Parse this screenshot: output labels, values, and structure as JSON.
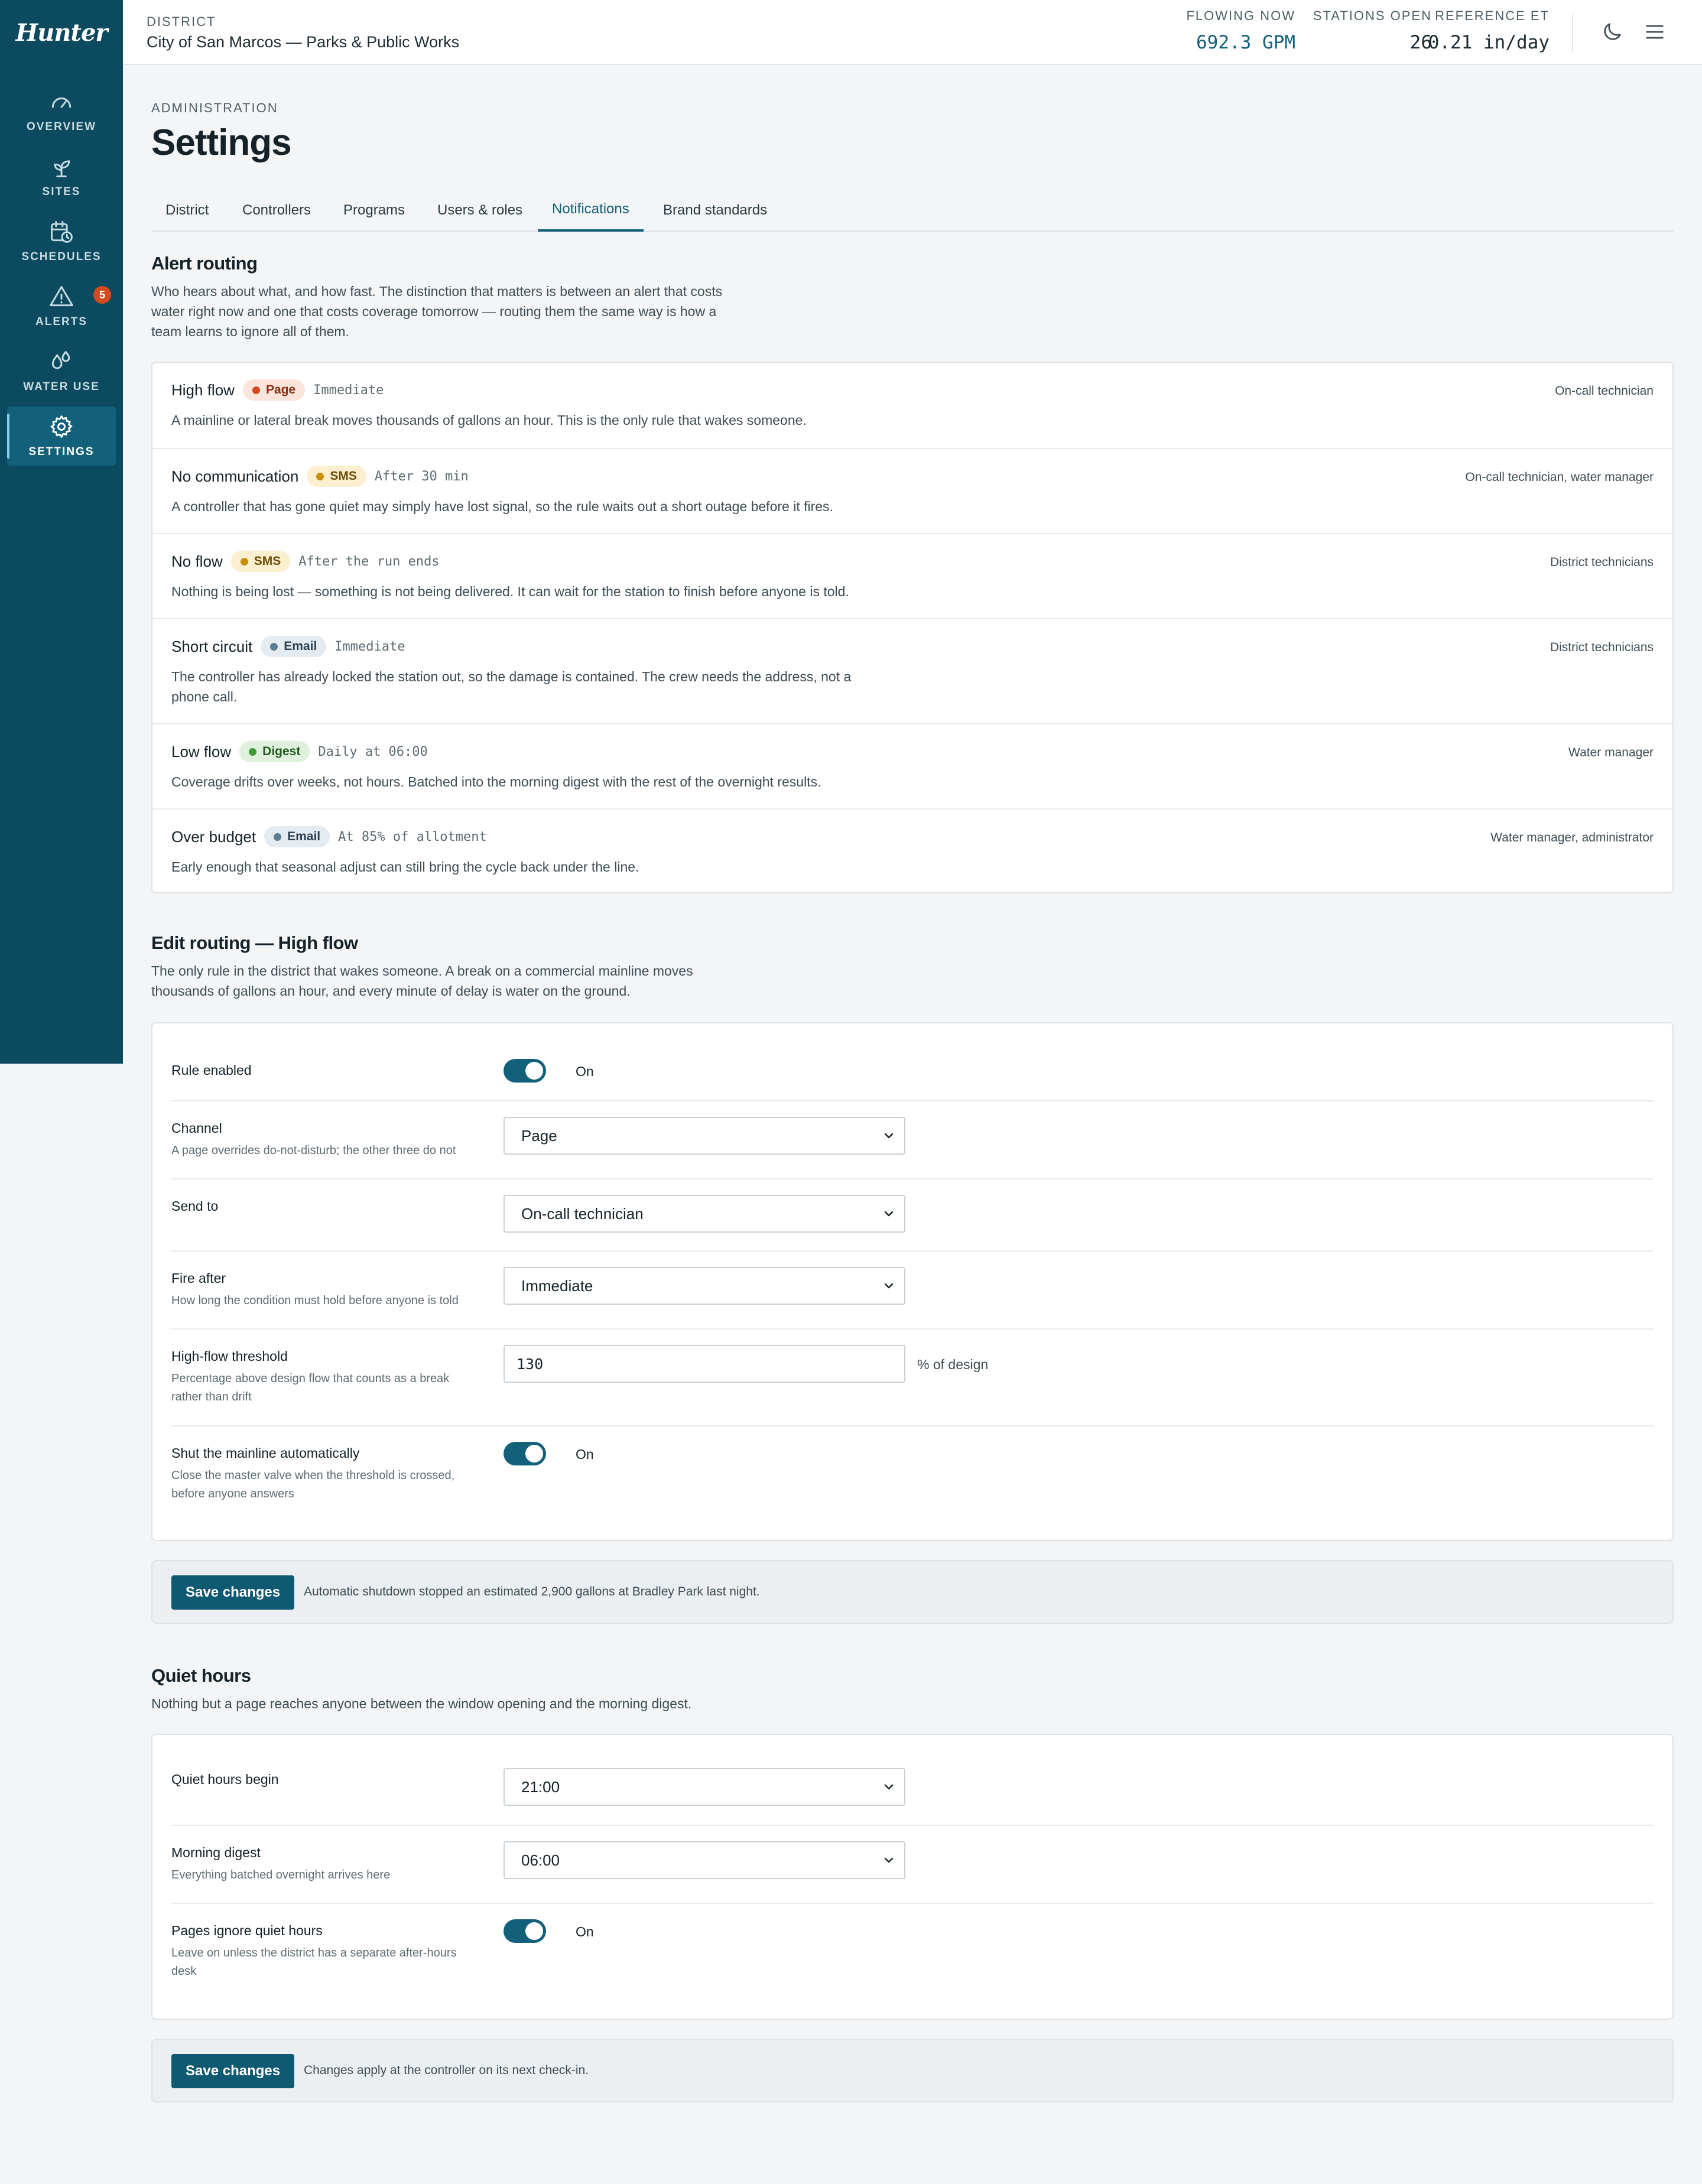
{
  "brand": {
    "logo_text": "Hunter"
  },
  "sidebar": {
    "items": [
      {
        "label": "OVERVIEW",
        "icon": "gauge-icon"
      },
      {
        "label": "SITES",
        "icon": "sprout-icon"
      },
      {
        "label": "SCHEDULES",
        "icon": "calendar-clock-icon"
      },
      {
        "label": "ALERTS",
        "icon": "warning-triangle-icon",
        "badge": "5"
      },
      {
        "label": "WATER USE",
        "icon": "droplets-icon"
      },
      {
        "label": "SETTINGS",
        "icon": "gear-icon",
        "active": true
      }
    ]
  },
  "header": {
    "district_label": "DISTRICT",
    "district_name": "City of San Marcos — Parks & Public Works",
    "stats": [
      {
        "label": "FLOWING NOW",
        "value": "692.3 GPM"
      },
      {
        "label": "STATIONS OPEN",
        "value": "26"
      },
      {
        "label": "REFERENCE ET",
        "value": "0.21 in/day"
      }
    ],
    "icons": [
      "moon-icon",
      "menu-icon"
    ]
  },
  "page": {
    "eyebrow": "ADMINISTRATION",
    "title": "Settings",
    "tabs": [
      "District",
      "Controllers",
      "Programs",
      "Users & roles",
      "Notifications",
      "Brand standards"
    ],
    "active_tab": "Notifications"
  },
  "alert_routing": {
    "title": "Alert routing",
    "description": "Who hears about what, and how fast. The distinction that matters is between an alert that costs water right now and one that costs coverage tomorrow — routing them the same way is how a team learns to ignore all of them.",
    "rules": [
      {
        "name": "High flow",
        "channel": "Page",
        "timing": "Immediate",
        "recipients": "On-call technician",
        "description": "A mainline or lateral break moves thousands of gallons an hour. This is the only rule that wakes someone."
      },
      {
        "name": "No communication",
        "channel": "SMS",
        "timing": "After 30 min",
        "recipients": "On-call technician, water manager",
        "description": "A controller that has gone quiet may simply have lost signal, so the rule waits out a short outage before it fires."
      },
      {
        "name": "No flow",
        "channel": "SMS",
        "timing": "After the run ends",
        "recipients": "District technicians",
        "description": "Nothing is being lost — something is not being delivered. It can wait for the station to finish before anyone is told."
      },
      {
        "name": "Short circuit",
        "channel": "Email",
        "timing": "Immediate",
        "recipients": "District technicians",
        "description": "The controller has already locked the station out, so the damage is contained. The crew needs the address, not a phone call."
      },
      {
        "name": "Low flow",
        "channel": "Digest",
        "timing": "Daily at 06:00",
        "recipients": "Water manager",
        "description": "Coverage drifts over weeks, not hours. Batched into the morning digest with the rest of the overnight results."
      },
      {
        "name": "Over budget",
        "channel": "Email",
        "timing": "At 85% of allotment",
        "recipients": "Water manager, administrator",
        "description": "Early enough that seasonal adjust can still bring the cycle back under the line."
      }
    ]
  },
  "edit_routing": {
    "title": "Edit routing — High flow",
    "description": "The only rule in the district that wakes someone. A break on a commercial mainline moves thousands of gallons an hour, and every minute of delay is water on the ground.",
    "rule_enabled": {
      "label": "Rule enabled",
      "state": "On"
    },
    "channel": {
      "label": "Channel",
      "help": "A page overrides do-not-disturb; the other three do not",
      "value": "Page"
    },
    "send_to": {
      "label": "Send to",
      "value": "On-call technician"
    },
    "fire_after": {
      "label": "Fire after",
      "help": "How long the condition must hold before anyone is told",
      "value": "Immediate"
    },
    "threshold": {
      "label": "High-flow threshold",
      "help": "Percentage above design flow that counts as a break rather than drift",
      "value": "130",
      "suffix": "% of design"
    },
    "shutoff": {
      "label": "Shut the mainline automatically",
      "help": "Close the master valve when the threshold is crossed, before anyone answers",
      "state": "On"
    },
    "save_label": "Save changes",
    "save_note": "Automatic shutdown stopped an estimated 2,900 gallons at Bradley Park last night."
  },
  "quiet_hours": {
    "title": "Quiet hours",
    "description": "Nothing but a page reaches anyone between the window opening and the morning digest.",
    "begin": {
      "label": "Quiet hours begin",
      "value": "21:00"
    },
    "digest": {
      "label": "Morning digest",
      "help": "Everything batched overnight arrives here",
      "value": "06:00"
    },
    "pages_ignore": {
      "label": "Pages ignore quiet hours",
      "help": "Leave on unless the district has a separate after-hours desk",
      "state": "On"
    },
    "save_label": "Save changes",
    "save_note": "Changes apply at the controller on its next check-in."
  },
  "colors": {
    "sidebar": "#0c4a5f",
    "accent": "#13607a",
    "page_chip": "#d44a1f",
    "sms_chip": "#c98f0a",
    "email_chip": "#5b7b93",
    "digest_chip": "#3f9a3a"
  }
}
